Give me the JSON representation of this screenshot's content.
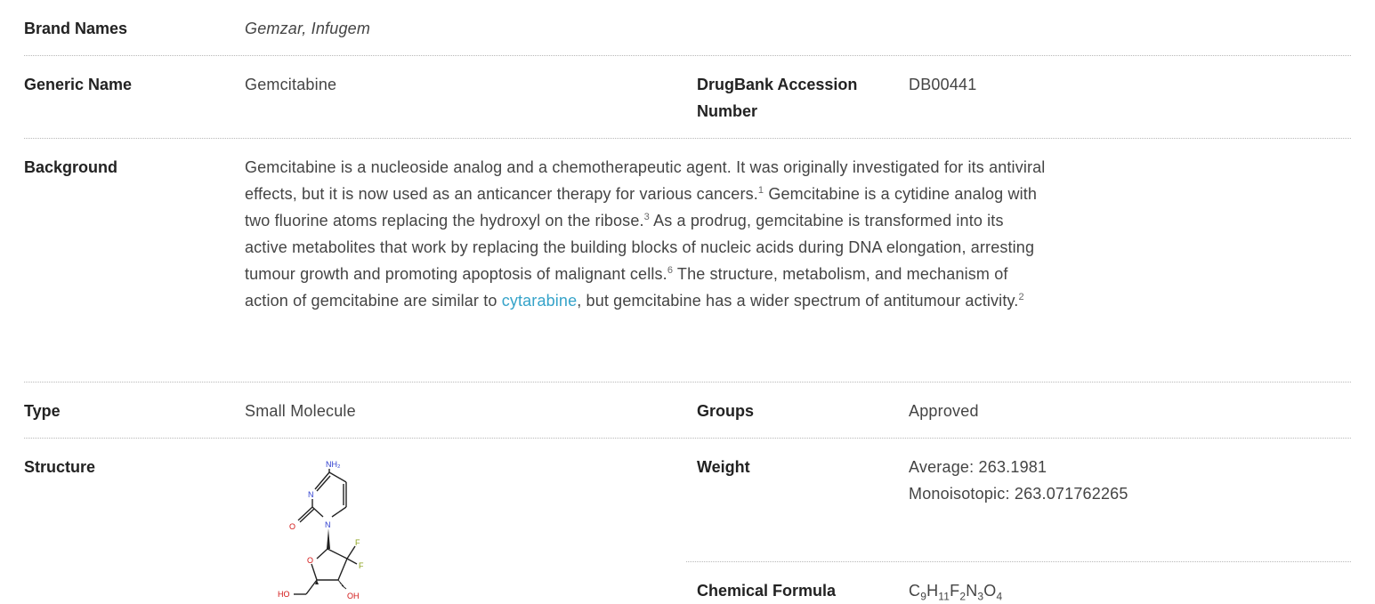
{
  "brand_names": {
    "label": "Brand Names",
    "value": "Gemzar, Infugem"
  },
  "generic_name": {
    "label": "Generic Name",
    "value": "Gemcitabine"
  },
  "accession": {
    "label_line1": "DrugBank Accession",
    "label_line2": "Number",
    "value": "DB00441"
  },
  "background": {
    "label": "Background",
    "p1": "Gemcitabine is a nucleoside analog and a chemotherapeutic agent. It was originally investigated for its antiviral effects, but it is now used as an anticancer therapy for various cancers.",
    "ref1": "1",
    "p2": " Gemcitabine is a cytidine analog with two fluorine atoms replacing the hydroxyl on the ribose.",
    "ref2": "3",
    "p3": " As a prodrug, gemcitabine is transformed into its active metabolites that work by replacing the building blocks of nucleic acids during DNA elongation, arresting tumour growth and promoting apoptosis of malignant cells.",
    "ref3": "6",
    "p4": "  The structure, metabolism, and mechanism of action of gemcitabine are similar to ",
    "link": "cytarabine",
    "p5": ", but gemcitabine has a wider spectrum of antitumour activity.",
    "ref4": "2"
  },
  "type": {
    "label": "Type",
    "value": "Small Molecule"
  },
  "groups": {
    "label": "Groups",
    "value": "Approved"
  },
  "structure": {
    "label": "Structure",
    "atoms": {
      "nh2": "NH₂",
      "n1": "N",
      "n2": "N",
      "o1": "O",
      "o2": "O",
      "f1": "F",
      "f2": "F",
      "ho": "HO",
      "oh": "OH"
    },
    "colors": {
      "nitrogen": "#2f3fcf",
      "oxygen": "#d21414",
      "fluorine": "#8aa019",
      "bond": "#222222"
    }
  },
  "weight": {
    "label": "Weight",
    "average": "Average: 263.1981",
    "mono": "Monoisotopic: 263.071762265"
  },
  "formula": {
    "label": "Chemical Formula",
    "parts": [
      {
        "el": "C",
        "n": "9"
      },
      {
        "el": "H",
        "n": "11"
      },
      {
        "el": "F",
        "n": "2"
      },
      {
        "el": "N",
        "n": "3"
      },
      {
        "el": "O",
        "n": "4"
      }
    ]
  }
}
